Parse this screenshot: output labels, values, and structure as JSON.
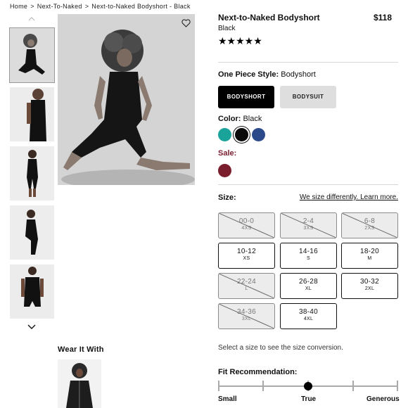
{
  "breadcrumb": [
    "Home",
    "Next-To-Naked",
    "Next-to-Naked Bodyshort - Black"
  ],
  "product": {
    "title": "Next-to-Naked Bodyshort",
    "price": "$118",
    "color_name": "Black",
    "stars": "★★★★★",
    "rating": 5
  },
  "style": {
    "label": "One Piece Style:",
    "value": "Bodyshort",
    "options": [
      "BODYSHORT",
      "BODYSUIT"
    ],
    "selected": "BODYSHORT"
  },
  "color": {
    "label": "Color:",
    "value": "Black",
    "swatches": [
      "#1aa39a",
      "#0a0a0a",
      "#2c4a8a"
    ],
    "selected_index": 1
  },
  "sale": {
    "label": "Sale:",
    "swatch": "#7a1e2e"
  },
  "size": {
    "label": "Size:",
    "guide_link": "We size differently. Learn more.",
    "options": [
      {
        "num": "00-0",
        "code": "4XS",
        "available": false
      },
      {
        "num": "2-4",
        "code": "3XS",
        "available": false
      },
      {
        "num": "6-8",
        "code": "2XS",
        "available": false
      },
      {
        "num": "10-12",
        "code": "XS",
        "available": true
      },
      {
        "num": "14-16",
        "code": "S",
        "available": true
      },
      {
        "num": "18-20",
        "code": "M",
        "available": true
      },
      {
        "num": "22-24",
        "code": "L",
        "available": false
      },
      {
        "num": "26-28",
        "code": "XL",
        "available": true
      },
      {
        "num": "30-32",
        "code": "2XL",
        "available": true
      },
      {
        "num": "34-36",
        "code": "3XL",
        "available": false
      },
      {
        "num": "38-40",
        "code": "4XL",
        "available": true
      }
    ],
    "conversion_hint": "Select a size to see the size conversion."
  },
  "fit": {
    "label": "Fit Recommendation:",
    "left": "Small",
    "center": "True",
    "right": "Generous"
  },
  "wear_with": {
    "title": "Wear It With"
  },
  "icons": {
    "heart": "heart-icon",
    "up": "chevron-up-icon",
    "down": "chevron-down-icon"
  }
}
